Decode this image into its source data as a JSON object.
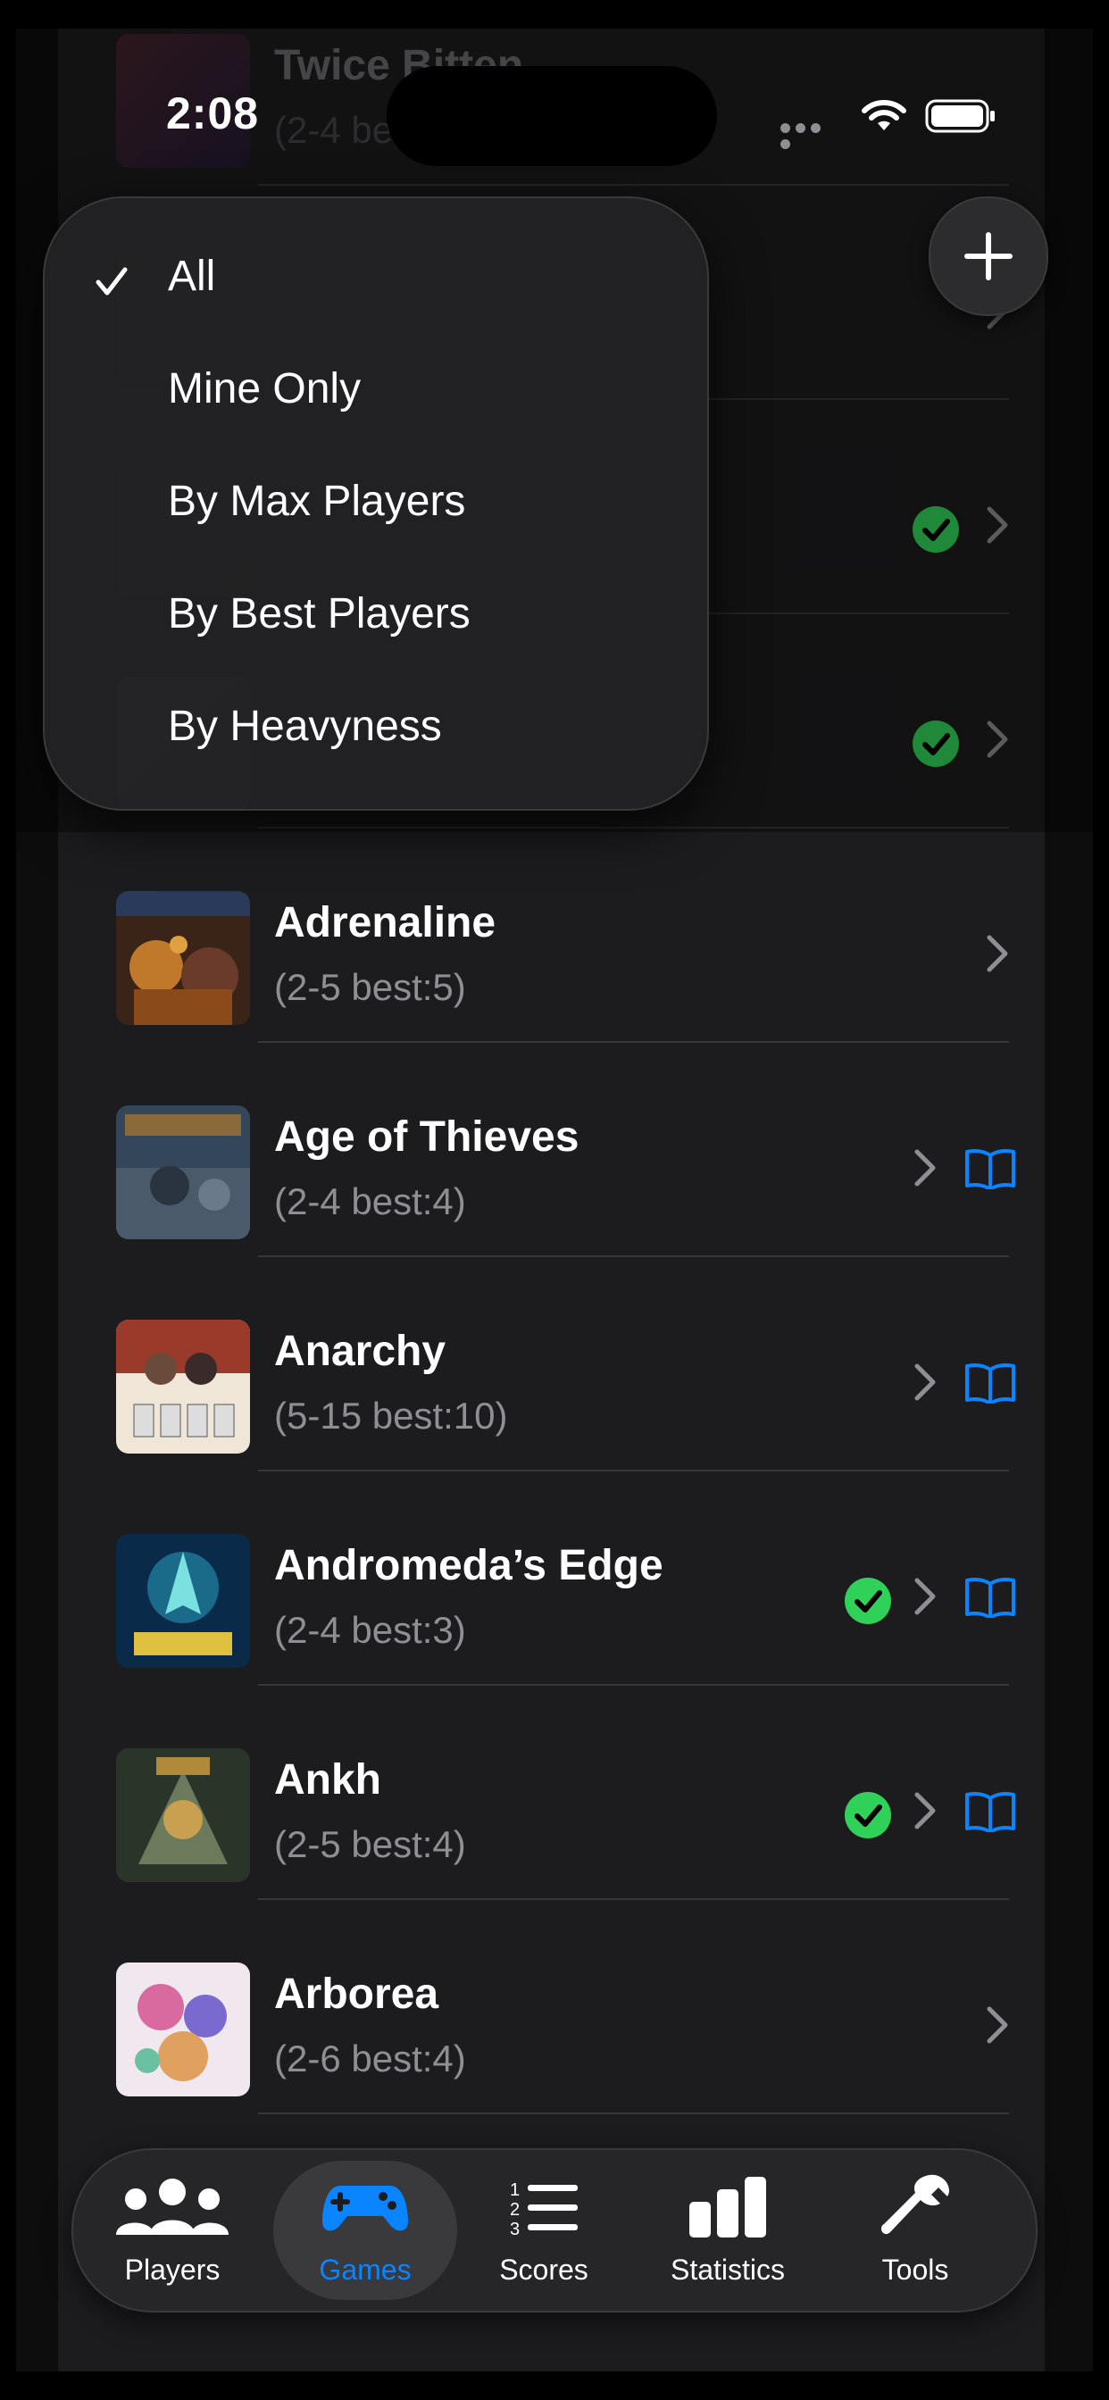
{
  "status_bar": {
    "time": "2:08"
  },
  "filter_menu": {
    "items": [
      {
        "label": "All",
        "selected": true
      },
      {
        "label": "Mine Only",
        "selected": false
      },
      {
        "label": "By Max Players",
        "selected": false
      },
      {
        "label": "By Best Players",
        "selected": false
      },
      {
        "label": "By Heavyness",
        "selected": false
      }
    ]
  },
  "games": [
    {
      "title": "Twice Bitten",
      "subtitle": "(2-4 best:4)",
      "owned": false,
      "rules": false
    },
    {
      "title": "",
      "subtitle": "",
      "owned": false,
      "rules": false
    },
    {
      "title": "",
      "subtitle": "",
      "owned": true,
      "rules": false
    },
    {
      "title": "",
      "subtitle": "",
      "owned": true,
      "rules": false
    },
    {
      "title": "Adrenaline",
      "subtitle": "(2-5 best:5)",
      "owned": false,
      "rules": false
    },
    {
      "title": "Age of Thieves",
      "subtitle": "(2-4 best:4)",
      "owned": false,
      "rules": true
    },
    {
      "title": "Anarchy",
      "subtitle": "(5-15 best:10)",
      "owned": false,
      "rules": true
    },
    {
      "title": "Andromeda’s Edge",
      "subtitle": "(2-4 best:3)",
      "owned": true,
      "rules": true
    },
    {
      "title": "Ankh",
      "subtitle": "(2-5 best:4)",
      "owned": true,
      "rules": true
    },
    {
      "title": "Arborea",
      "subtitle": "(2-6 best:4)",
      "owned": false,
      "rules": false
    }
  ],
  "tab_bar": {
    "tabs": [
      {
        "label": "Players",
        "icon": "people-icon",
        "active": false
      },
      {
        "label": "Games",
        "icon": "gamecontroller-icon",
        "active": true
      },
      {
        "label": "Scores",
        "icon": "numbered-list-icon",
        "active": false
      },
      {
        "label": "Statistics",
        "icon": "bar-chart-icon",
        "active": false
      },
      {
        "label": "Tools",
        "icon": "wrench-icon",
        "active": false
      }
    ]
  },
  "colors": {
    "accent": "#0a84ff",
    "owned_check": "#30d158",
    "background": "#1c1c1e",
    "secondary_text": "#8e8e93"
  }
}
